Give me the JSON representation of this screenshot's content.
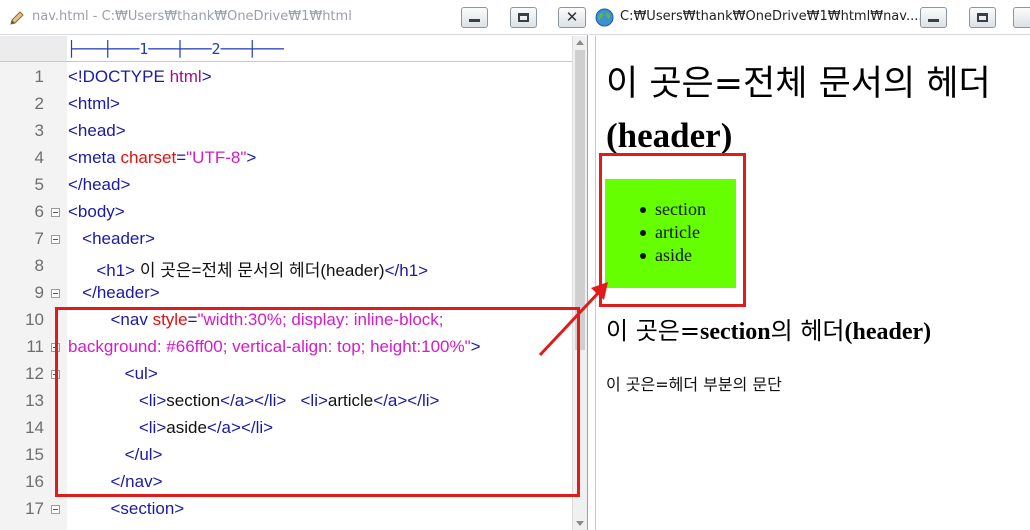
{
  "editor": {
    "title": "nav.html - C:₩Users₩thank₩OneDrive₩1₩html",
    "ruler": "├───┼───1───┼───2───┼───",
    "lines": [
      {
        "n": "1",
        "parts": [
          {
            "t": "<!DOCTYPE ",
            "c": "tag"
          },
          {
            "t": "html",
            "c": "kw"
          },
          {
            "t": ">",
            "c": "tag"
          }
        ]
      },
      {
        "n": "2",
        "parts": [
          {
            "t": "<html>",
            "c": "tag"
          }
        ]
      },
      {
        "n": "3",
        "parts": [
          {
            "t": "<head>",
            "c": "tag"
          }
        ]
      },
      {
        "n": "4",
        "parts": [
          {
            "t": "<meta ",
            "c": "tag"
          },
          {
            "t": "charset",
            "c": "attr"
          },
          {
            "t": "=",
            "c": "tag"
          },
          {
            "t": "\"UTF-8\"",
            "c": "val"
          },
          {
            "t": ">",
            "c": "tag"
          }
        ]
      },
      {
        "n": "5",
        "parts": [
          {
            "t": "</head>",
            "c": "tag"
          }
        ]
      },
      {
        "n": "6",
        "parts": [
          {
            "t": "<body>",
            "c": "tag"
          }
        ]
      },
      {
        "n": "7",
        "parts": [
          {
            "t": "   <header>",
            "c": "tag"
          }
        ]
      },
      {
        "n": "8",
        "parts": [
          {
            "t": "      <h1>",
            "c": "tag"
          },
          {
            "t": " 이 곳은=전체 문서의 헤더(header)",
            "c": "txt"
          },
          {
            "t": "</h1>",
            "c": "tag"
          }
        ]
      },
      {
        "n": "9",
        "parts": [
          {
            "t": "   </header>",
            "c": "tag"
          }
        ]
      },
      {
        "n": "10",
        "parts": [
          {
            "t": "         <nav ",
            "c": "tag"
          },
          {
            "t": "style",
            "c": "attr"
          },
          {
            "t": "=",
            "c": "tag"
          },
          {
            "t": "\"width:30%; display: inline-block;",
            "c": "val"
          }
        ]
      },
      {
        "n": "11",
        "parts": [
          {
            "t": "background: #66ff00; vertical-align: top; height:100%\"",
            "c": "val"
          },
          {
            "t": ">",
            "c": "tag"
          }
        ]
      },
      {
        "n": "12",
        "parts": [
          {
            "t": "            <ul>",
            "c": "tag"
          }
        ]
      },
      {
        "n": "13",
        "parts": [
          {
            "t": "               <li>",
            "c": "tag"
          },
          {
            "t": "section",
            "c": "txt"
          },
          {
            "t": "</a></li>",
            "c": "tag"
          },
          {
            "t": "   ",
            "c": "txt"
          },
          {
            "t": "<li>",
            "c": "tag"
          },
          {
            "t": "article",
            "c": "txt"
          },
          {
            "t": "</a></li>",
            "c": "tag"
          }
        ]
      },
      {
        "n": "14",
        "parts": [
          {
            "t": "               <li>",
            "c": "tag"
          },
          {
            "t": "aside",
            "c": "txt"
          },
          {
            "t": "</a></li>",
            "c": "tag"
          }
        ]
      },
      {
        "n": "15",
        "parts": [
          {
            "t": "            </ul>",
            "c": "tag"
          }
        ]
      },
      {
        "n": "16",
        "parts": [
          {
            "t": "         </nav>",
            "c": "tag"
          }
        ]
      },
      {
        "n": "17",
        "parts": [
          {
            "t": "         <section>",
            "c": "tag"
          }
        ]
      }
    ],
    "fold_markers": {
      "6": "minus",
      "7": "minus",
      "9": "minus",
      "11": "plus",
      "12": "minus",
      "17": "minus"
    }
  },
  "browser": {
    "title": "C:₩Users₩thank₩OneDrive₩1₩html₩nav....",
    "h1_text": "이 곳은=전체 문서의 헤더",
    "h1_bold": "(header)",
    "nav_items": [
      "section",
      "article",
      "aside"
    ],
    "nav_color": "#66ff00",
    "h2_a": "이 곳은=",
    "h2_b": "section",
    "h2_c": "의 헤더",
    "h2_d": "(header)",
    "paragraph": "이 곳은=헤더 부분의 문단"
  },
  "annotation_color": "#e01b1b"
}
